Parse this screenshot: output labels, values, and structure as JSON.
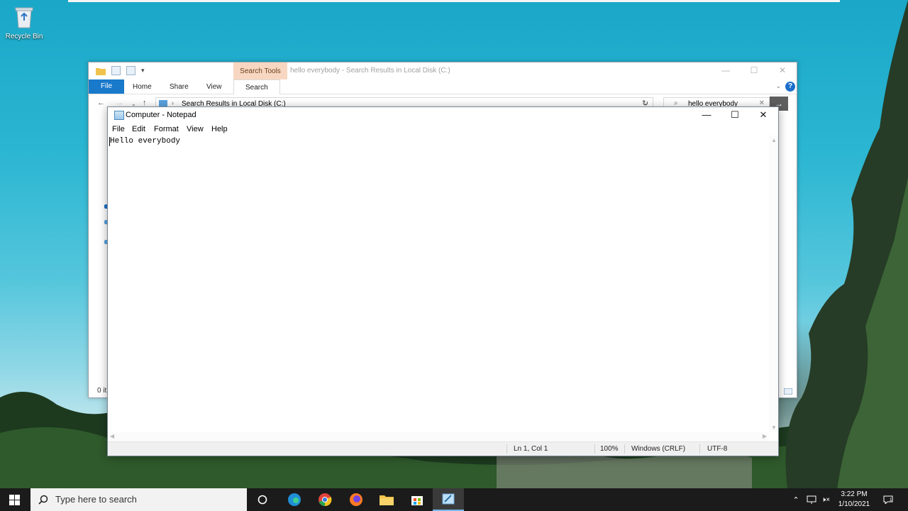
{
  "desktop": {
    "recycle_bin_label": "Recycle Bin"
  },
  "explorer": {
    "title": "hello everybody - Search Results in Local Disk (C:)",
    "context_tab": "Search Tools",
    "tabs": [
      "Home",
      "Share",
      "View",
      "Search"
    ],
    "file_tab": "File",
    "address": "Search Results in Local Disk (C:)",
    "search_value": "hello everybody",
    "status": "0 it"
  },
  "notepad": {
    "title": "Computer - Notepad",
    "menu": [
      "File",
      "Edit",
      "Format",
      "View",
      "Help"
    ],
    "content": "Hello everybody",
    "status": {
      "position": "Ln 1, Col 1",
      "zoom": "100%",
      "line_ending": "Windows (CRLF)",
      "encoding": "UTF-8"
    }
  },
  "taskbar": {
    "search_placeholder": "Type here to search",
    "apps": [
      "cortana-icon",
      "edge-icon",
      "chrome-icon",
      "firefox-icon",
      "file-explorer-icon",
      "store-icon",
      "notepad-icon"
    ],
    "time": "3:22 PM",
    "date": "1/10/2021"
  },
  "colors": {
    "accent": "#1979ca",
    "context_tab": "#f7d7c1",
    "taskbar": "#1b1b1b"
  }
}
